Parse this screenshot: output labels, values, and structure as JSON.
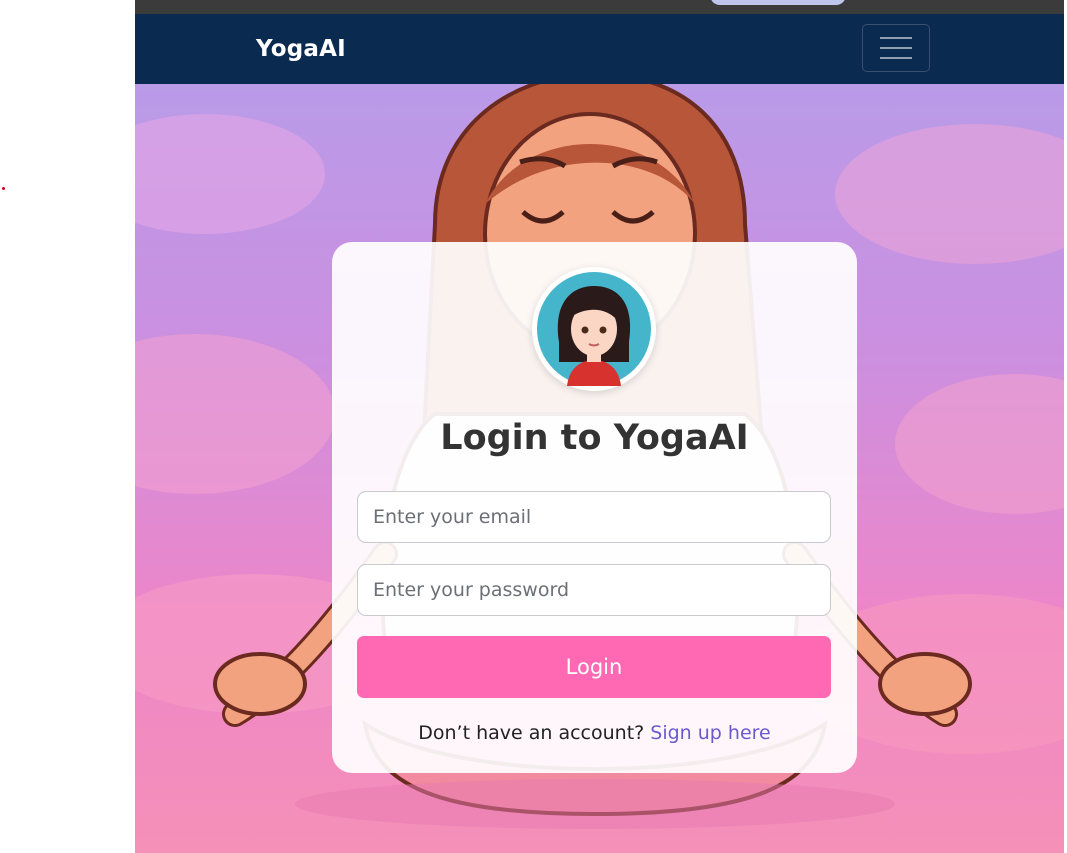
{
  "navbar": {
    "brand": "YogaAI",
    "menu_icon": "hamburger-menu-icon"
  },
  "login": {
    "title": "Login to YogaAI",
    "email_placeholder": "Enter your email",
    "password_placeholder": "Enter your password",
    "submit_label": "Login",
    "signup_prompt": "Don’t have an account? ",
    "signup_link": "Sign up here"
  },
  "colors": {
    "navbar_bg": "#0a2a4f",
    "accent_button": "#ff69b4",
    "link": "#6a5acd"
  }
}
